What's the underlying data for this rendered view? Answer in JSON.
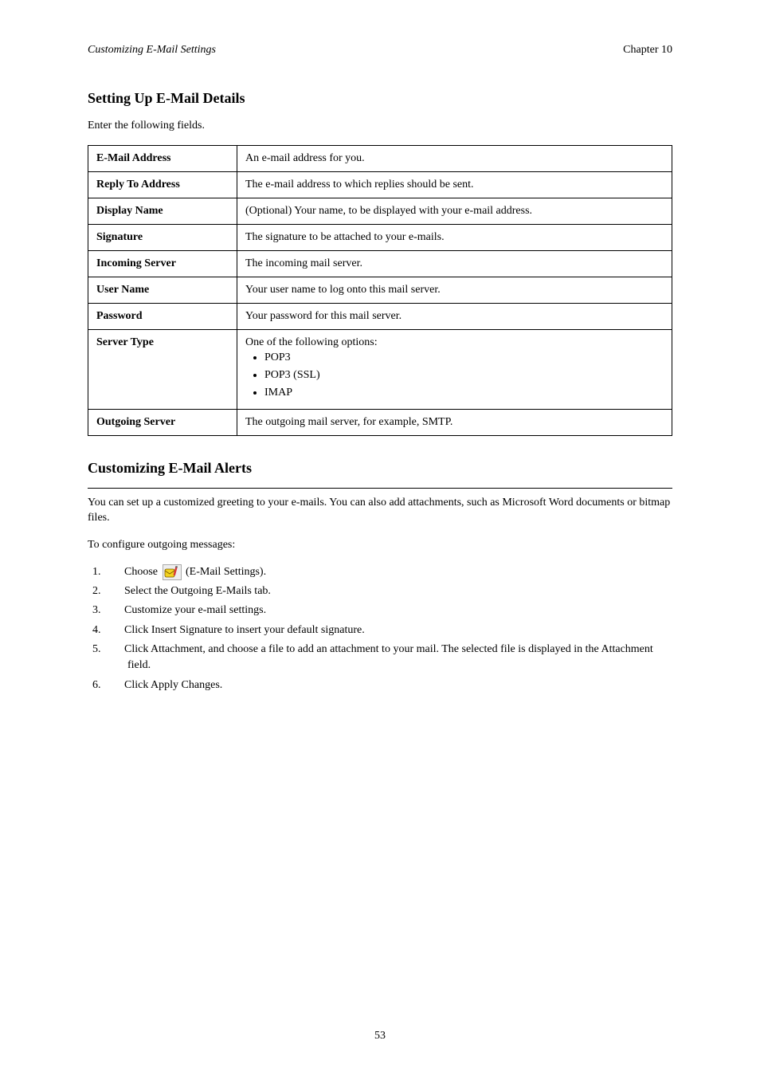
{
  "header": {
    "doc_title": "Customizing E-Mail Settings",
    "chapter": "Chapter 10"
  },
  "section1": {
    "heading": "Setting Up E-Mail Details",
    "intro": "Enter the following fields.",
    "rows": [
      {
        "field": "E-Mail Address",
        "desc": "An e-mail address for you."
      },
      {
        "field": "Reply To Address",
        "desc": "The e-mail address to which replies should be sent."
      },
      {
        "field": "Display Name",
        "desc": "(Optional) Your name, to be displayed with your e-mail address."
      },
      {
        "field": "Signature",
        "desc": "The signature to be attached to your e-mails."
      },
      {
        "field": "Incoming Server",
        "desc": "The incoming mail server."
      },
      {
        "field": "User Name",
        "desc": "Your user name to log onto this mail server."
      },
      {
        "field": "Password",
        "desc": "Your password for this mail server."
      },
      {
        "field": "Server Type",
        "desc": "One of the following options:",
        "bullets": [
          "POP3",
          "POP3 (SSL)",
          "IMAP"
        ]
      },
      {
        "field": "Outgoing Server",
        "desc": "The outgoing mail server, for example, SMTP."
      }
    ]
  },
  "section2": {
    "heading": "Customizing E-Mail Alerts",
    "para1": "You can set up a customized greeting to your e-mails. You can also add attachments, such as Microsoft Word documents or bitmap files.",
    "to_line": "To configure outgoing messages:",
    "steps": [
      {
        "num": "1.",
        "pre": "Choose ",
        "icon": "mailbox-edit-icon",
        "post": " (E-Mail Settings)."
      },
      {
        "num": "2.",
        "text": "Select the Outgoing E-Mails tab."
      },
      {
        "num": "3.",
        "text": "Customize your e-mail settings."
      },
      {
        "num": "4.",
        "text": "Click Insert Signature to insert your default signature."
      },
      {
        "num": "5.",
        "text": "Click Attachment, and choose a file to add an attachment to your mail. The selected file is displayed in the Attachment field."
      },
      {
        "num": "6.",
        "text": "Click Apply Changes."
      }
    ]
  },
  "footer": {
    "page_number": "53"
  }
}
